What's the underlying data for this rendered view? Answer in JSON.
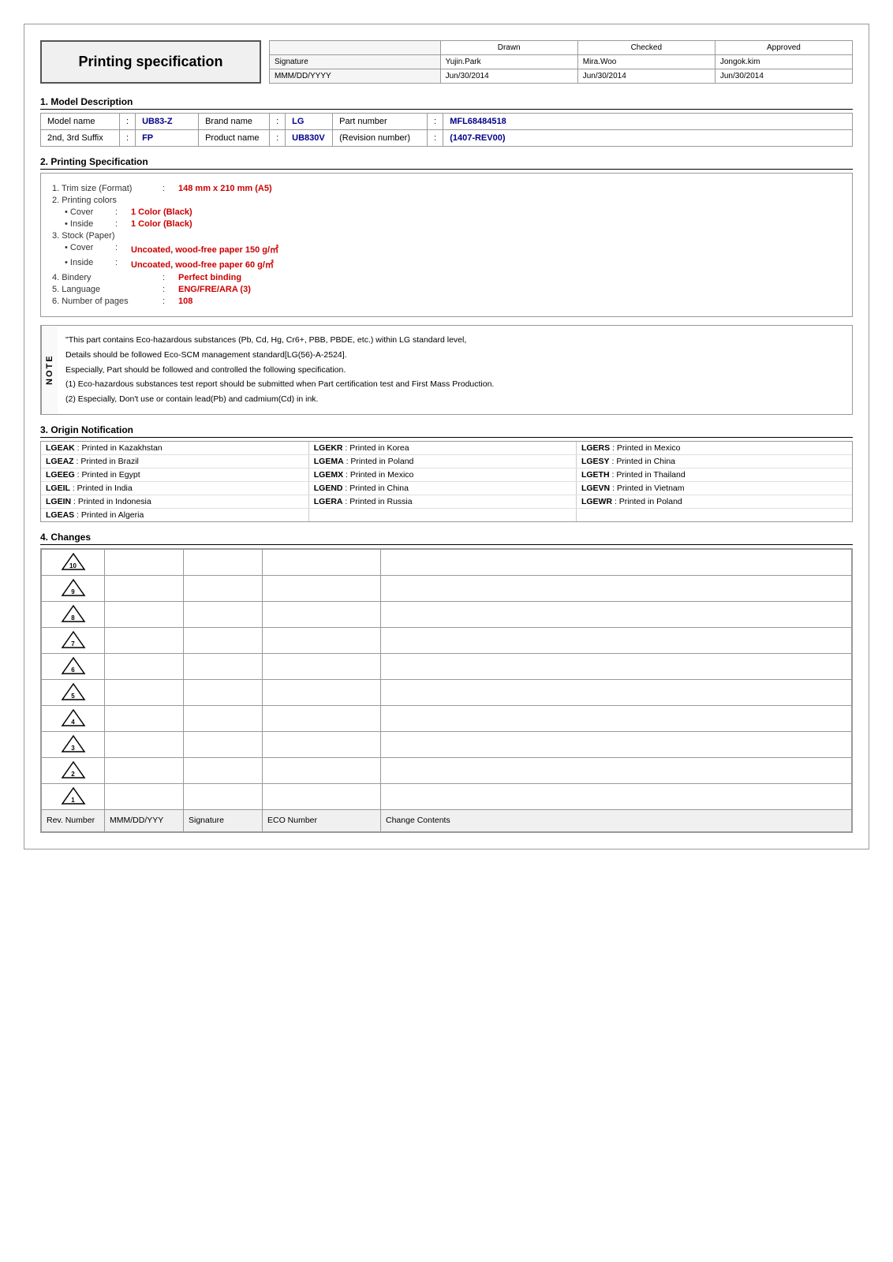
{
  "header": {
    "title": "Printing specification",
    "table": {
      "cols": [
        "",
        "Drawn",
        "Checked",
        "Approved"
      ],
      "rows": [
        [
          "Signature",
          "Yujin.Park",
          "Mira.Woo",
          "Jongok.kim"
        ],
        [
          "MMM/DD/YYYY",
          "Jun/30/2014",
          "Jun/30/2014",
          "Jun/30/2014"
        ]
      ]
    }
  },
  "sections": {
    "model": {
      "title": "1. Model Description",
      "rows": [
        {
          "label": "Model name",
          "colon": ":",
          "value": "UB83-Z",
          "label2": "Brand name",
          "colon2": ":",
          "value2": "LG",
          "label3": "Part number",
          "colon3": ":",
          "value3": "MFL68484518"
        },
        {
          "label": "2nd, 3rd Suffix",
          "colon": ":",
          "value": "FP",
          "label2": "Product name",
          "colon2": ":",
          "value2": "UB830V",
          "label3": "(Revision number)",
          "colon3": ":",
          "value3": "(1407-REV00)"
        }
      ]
    },
    "printing": {
      "title": "2. Printing Specification",
      "items": [
        {
          "num": "1.",
          "label": "Trim size (Format)",
          "colon": ":",
          "value": "148 mm x 210 mm (A5)",
          "indent": 0
        },
        {
          "num": "2.",
          "label": "Printing colors",
          "colon": "",
          "value": "",
          "indent": 0
        },
        {
          "num": "",
          "label": "• Cover",
          "colon": ":",
          "value": "1 Color (Black)",
          "indent": 1
        },
        {
          "num": "",
          "label": "• Inside",
          "colon": ":",
          "value": "1 Color (Black)",
          "indent": 1
        },
        {
          "num": "3.",
          "label": "Stock (Paper)",
          "colon": "",
          "value": "",
          "indent": 0
        },
        {
          "num": "",
          "label": "• Cover",
          "colon": ":",
          "value": "Uncoated, wood-free paper 150 g/㎡",
          "indent": 1
        },
        {
          "num": "",
          "label": "• Inside",
          "colon": ":",
          "value": "Uncoated, wood-free paper 60 g/㎡",
          "indent": 1
        },
        {
          "num": "4.",
          "label": "Bindery",
          "colon": ":",
          "value": "Perfect binding",
          "indent": 0
        },
        {
          "num": "5.",
          "label": "Language",
          "colon": ":",
          "value": "ENG/FRE/ARA (3)",
          "indent": 0
        },
        {
          "num": "6.",
          "label": "Number of pages",
          "colon": ":",
          "value": "108",
          "indent": 0
        }
      ]
    },
    "note": {
      "side": "NOTE",
      "lines": [
        "\"This part contains Eco-hazardous substances (Pb, Cd, Hg, Cr6+, PBB, PBDE, etc.) within LG standard level,",
        "Details should be followed Eco-SCM management standard[LG(56)-A-2524].",
        "Especially, Part should be followed and controlled the following specification.",
        "(1) Eco-hazardous substances test report should be submitted when Part certification test and First Mass Production.",
        "(2) Especially, Don't use or contain lead(Pb) and cadmium(Cd) in ink."
      ]
    },
    "origin": {
      "title": "3. Origin Notification",
      "entries": [
        [
          {
            "code": "LGEAK",
            "sep": ":",
            "country": "Printed in Kazakhstan"
          },
          {
            "code": "LGEKR",
            "sep": ":",
            "country": "Printed in Korea"
          },
          {
            "code": "LGERS",
            "sep": ":",
            "country": "Printed in Mexico"
          }
        ],
        [
          {
            "code": "LGEAZ",
            "sep": ":",
            "country": "Printed in Brazil"
          },
          {
            "code": "LGEMA",
            "sep": ":",
            "country": "Printed in Poland"
          },
          {
            "code": "LGESY",
            "sep": ":",
            "country": "Printed in China"
          }
        ],
        [
          {
            "code": "LGEEG",
            "sep": ":",
            "country": "Printed in Egypt"
          },
          {
            "code": "LGEMX",
            "sep": ":",
            "country": "Printed in Mexico"
          },
          {
            "code": "LGETH",
            "sep": ":",
            "country": "Printed in Thailand"
          }
        ],
        [
          {
            "code": "LGEIL",
            "sep": ":",
            "country": "Printed in India"
          },
          {
            "code": "LGEND",
            "sep": ":",
            "country": "Printed in China"
          },
          {
            "code": "LGEVN",
            "sep": ":",
            "country": "Printed in Vietnam"
          }
        ],
        [
          {
            "code": "LGEIN",
            "sep": ":",
            "country": "Printed in Indonesia"
          },
          {
            "code": "LGERA",
            "sep": ":",
            "country": "Printed in Russia"
          },
          {
            "code": "LGEWR",
            "sep": ":",
            "country": "Printed in Poland"
          }
        ],
        [
          {
            "code": "LGEAS",
            "sep": ":",
            "country": "Printed in Algeria"
          },
          {
            "code": "",
            "sep": "",
            "country": ""
          },
          {
            "code": "",
            "sep": "",
            "country": ""
          }
        ]
      ]
    },
    "changes": {
      "title": "4. Changes",
      "revisions": [
        10,
        9,
        8,
        7,
        6,
        5,
        4,
        3,
        2,
        1
      ],
      "footer": {
        "col1": "Rev. Number",
        "col2": "MMM/DD/YYY",
        "col3": "Signature",
        "col4": "ECO Number",
        "col5": "Change Contents"
      }
    }
  }
}
